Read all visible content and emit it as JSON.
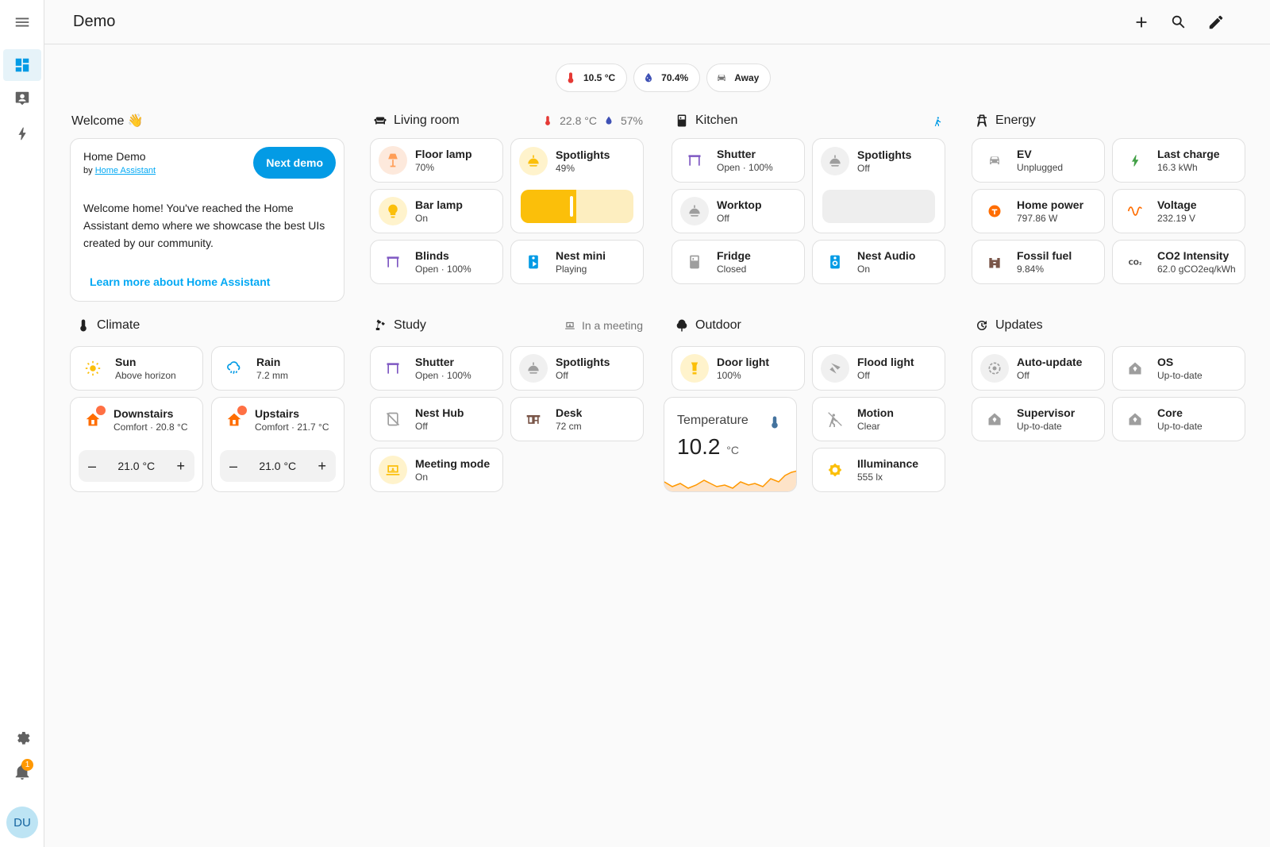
{
  "header": {
    "title": "Demo"
  },
  "sidebar": {
    "notifications_count": "1",
    "avatar_initials": "DU"
  },
  "badges": [
    {
      "icon": "thermometer-icon",
      "value": "10.5 °C"
    },
    {
      "icon": "water-percent-icon",
      "value": "70.4%"
    },
    {
      "icon": "car-icon",
      "value": "Away"
    }
  ],
  "welcome": {
    "section_title": "Welcome 👋",
    "card_title": "Home Demo",
    "by_prefix": "by ",
    "by_link": "Home Assistant",
    "next_button": "Next demo",
    "body": "Welcome home! You've reached the Home Assistant demo where we showcase the best UIs created by our community.",
    "learn_more": "Learn more about Home Assistant"
  },
  "living_room": {
    "title": "Living room",
    "temperature": "22.8 °C",
    "humidity": "57%",
    "tiles": [
      {
        "name": "Floor lamp",
        "state": "70%"
      },
      {
        "name": "Bar lamp",
        "state": "On"
      },
      {
        "name": "Blinds",
        "state": "Open · 100%"
      },
      {
        "name": "Spotlights",
        "state": "49%",
        "level": 0.49
      },
      {
        "name": "Nest mini",
        "state": "Playing"
      }
    ]
  },
  "kitchen": {
    "title": "Kitchen",
    "tiles": [
      {
        "name": "Shutter",
        "state": "Open · 100%"
      },
      {
        "name": "Worktop",
        "state": "Off"
      },
      {
        "name": "Fridge",
        "state": "Closed"
      },
      {
        "name": "Spotlights",
        "state": "Off"
      },
      {
        "name": "Nest Audio",
        "state": "On"
      }
    ]
  },
  "energy": {
    "title": "Energy",
    "tiles": [
      {
        "name": "EV",
        "state": "Unplugged"
      },
      {
        "name": "Last charge",
        "state": "16.3 kWh"
      },
      {
        "name": "Home power",
        "state": "797.86 W"
      },
      {
        "name": "Voltage",
        "state": "232.19 V"
      },
      {
        "name": "Fossil fuel",
        "state": "9.84%"
      },
      {
        "name": "CO2 Intensity",
        "state": "62.0 gCO2eq/kWh"
      }
    ]
  },
  "climate": {
    "title": "Climate",
    "tiles": [
      {
        "name": "Sun",
        "state": "Above horizon"
      },
      {
        "name": "Rain",
        "state": "7.2 mm"
      }
    ],
    "thermostats": [
      {
        "name": "Downstairs",
        "state": "Comfort · 20.8 °C",
        "target": "21.0 °C"
      },
      {
        "name": "Upstairs",
        "state": "Comfort · 21.7 °C",
        "target": "21.0 °C"
      }
    ]
  },
  "study": {
    "title": "Study",
    "status": "In a meeting",
    "tiles": [
      {
        "name": "Shutter",
        "state": "Open · 100%"
      },
      {
        "name": "Spotlights",
        "state": "Off"
      },
      {
        "name": "Nest Hub",
        "state": "Off"
      },
      {
        "name": "Desk",
        "state": "72 cm"
      },
      {
        "name": "Meeting mode",
        "state": "On"
      }
    ]
  },
  "outdoor": {
    "title": "Outdoor",
    "tiles": [
      {
        "name": "Door light",
        "state": "100%"
      },
      {
        "name": "Flood light",
        "state": "Off"
      },
      {
        "name": "Motion",
        "state": "Clear"
      },
      {
        "name": "Illuminance",
        "state": "555 lx"
      }
    ],
    "temperature_card": {
      "label": "Temperature",
      "value": "10.2",
      "unit": "°C"
    }
  },
  "updates": {
    "title": "Updates",
    "tiles": [
      {
        "name": "Auto-update",
        "state": "Off"
      },
      {
        "name": "OS",
        "state": "Up-to-date"
      },
      {
        "name": "Supervisor",
        "state": "Up-to-date"
      },
      {
        "name": "Core",
        "state": "Up-to-date"
      }
    ]
  },
  "colors": {
    "accent": "#039be5",
    "light_on": "#fbbf0a",
    "light_on_bg": "#fff3cc",
    "cover": "#7e57c2",
    "heat": "#ff6d00",
    "grey_icon": "#9e9e9e"
  }
}
